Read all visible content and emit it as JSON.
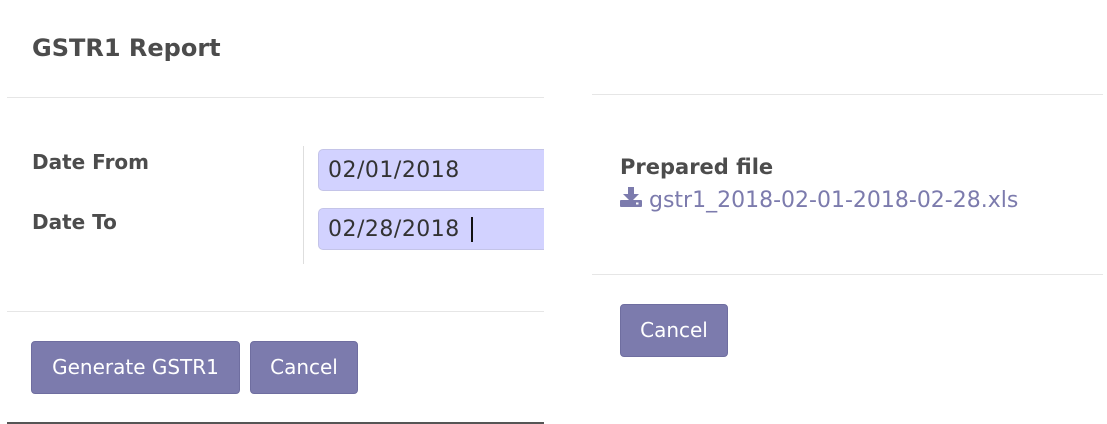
{
  "left_dialog": {
    "title": "GSTR1 Report",
    "fields": {
      "date_from": {
        "label": "Date From",
        "value": "02/01/2018"
      },
      "date_to": {
        "label": "Date To",
        "value": "02/28/2018"
      }
    },
    "buttons": {
      "generate": "Generate GSTR1",
      "cancel": "Cancel"
    }
  },
  "right_dialog": {
    "prepared_label": "Prepared file",
    "file_name": "gstr1_2018-02-01-2018-02-28.xls",
    "file_icon": "download-icon",
    "buttons": {
      "cancel": "Cancel"
    }
  },
  "colors": {
    "button_bg": "#7c7bad",
    "input_bg": "#d2d2ff",
    "link": "#7c7bad",
    "text": "#4c4c4c"
  }
}
